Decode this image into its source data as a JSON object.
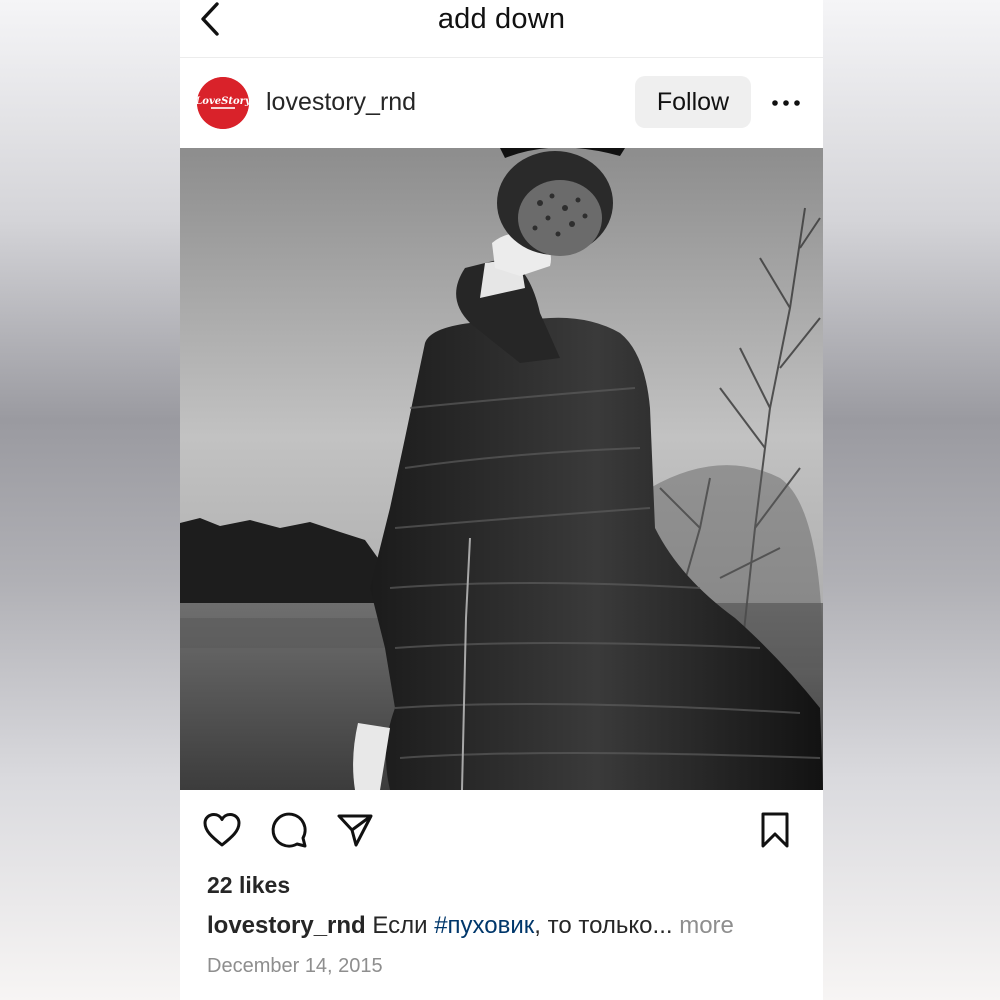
{
  "header": {
    "title": "add down",
    "back_icon": "chevron-left-icon"
  },
  "post": {
    "username": "lovestory_rnd",
    "avatar_logo_text": "LoveStory",
    "avatar_color": "#d9222a",
    "follow_label": "Follow",
    "more_icon": "ellipsis-icon",
    "photo_description_icon": "photo"
  },
  "actions": {
    "like_icon": "heart-icon",
    "comment_icon": "comment-icon",
    "share_icon": "send-icon",
    "save_icon": "bookmark-icon"
  },
  "stats": {
    "likes": "22 likes"
  },
  "caption": {
    "username": "lovestory_rnd",
    "text_before": " Если ",
    "hashtag": "#пуховик",
    "text_after": ", то только...",
    "more": " more"
  },
  "date": "December 14, 2015",
  "colors": {
    "hashtag": "#00376b",
    "muted": "#8e8e8e",
    "follow_bg": "#efefef"
  }
}
